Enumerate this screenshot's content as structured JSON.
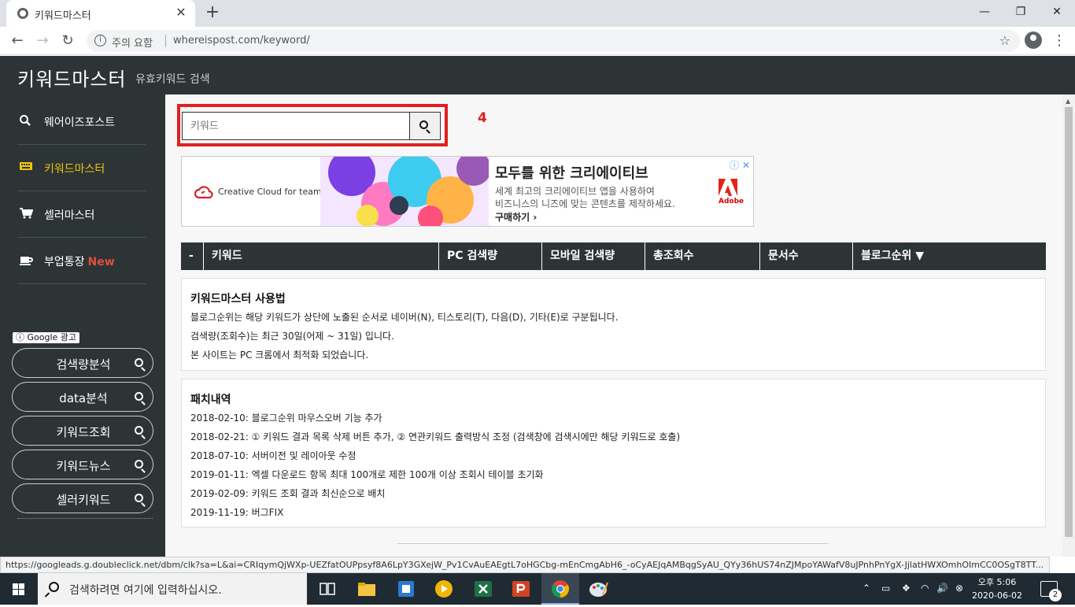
{
  "browser": {
    "tab_title": "키워드마스터",
    "new_tab": "+",
    "window_min": "—",
    "window_max": "❐",
    "window_close": "✕",
    "back": "←",
    "forward": "→",
    "reload": "↻",
    "security_info": "i",
    "security_text": "주의 요함",
    "url": "whereispost.com/keyword/",
    "bookmark_star": "☆",
    "menu": "⋮",
    "status_url": "https://googleads.g.doubleclick.net/dbm/clk?sa=L&ai=CRIqymQjWXp-UEZfatOUPpsyf8A6LpY3GXejW_Pv1CvAuEAEgtL7oHGCbg-mEnCmgAbH6_-oCyAEJqAMBqgSyAU_QYy36hUS74nZJMpoYAWafV8uJPnhPnYgX-JjlatHWXOmhOImCC0OSgT8TT..."
  },
  "site": {
    "title": "키워드마스터",
    "subtitle": "유효키워드 검색"
  },
  "sidebar": {
    "items": [
      {
        "label": "웨어이즈포스트",
        "icon": "search-icon",
        "glyph": "🔍"
      },
      {
        "label": "키워드마스터",
        "icon": "keyboard-icon",
        "glyph": "⌨"
      },
      {
        "label": "셀러마스터",
        "icon": "cart-icon",
        "glyph": "🛒"
      },
      {
        "label": "부업통장",
        "icon": "coffee-icon",
        "glyph": "☕",
        "badge": "New"
      }
    ],
    "google_ad_label": "ⓘ Google 광고",
    "ad_buttons": [
      "검색량분석",
      "data분석",
      "키워드조회",
      "키워드뉴스",
      "셀러키워드"
    ]
  },
  "search": {
    "placeholder": "키워드",
    "value": "",
    "annotation": "4"
  },
  "ad": {
    "brand_text": "Creative Cloud for teams",
    "headline": "모두를 위한 크리에이티브",
    "body_line1": "세계 최고의 크리에이티브 앱을 사용하여",
    "body_line2": "비즈니스의 니즈에 맞는 콘텐츠를 제작하세요.",
    "cta": "구매하기 ›",
    "adchoices": "ⓘ ✕",
    "adobe_text": "Adobe"
  },
  "table": {
    "headers": [
      "-",
      "키워드",
      "PC 검색량",
      "모바일 검색량",
      "총조회수",
      "문서수",
      "블로그순위 ▼"
    ]
  },
  "usage": {
    "title": "키워드마스터 사용법",
    "lines": [
      "블로그순위는 해당 키워드가 상단에 노출된 순서로 네이버(N), 티스토리(T), 다음(D), 기타(E)로 구분됩니다.",
      "검색량(조회수)는 최근 30일(어제 ~ 31일) 입니다.",
      "본 사이트는 PC 크롬에서 최적화 되었습니다."
    ]
  },
  "patch": {
    "title": "패치내역",
    "lines": [
      "2018-02-10: 블로그순위 마우스오버 기능 추가",
      "2018-02-21: ① 키워드 결과 목록 삭제 버튼 추가, ② 연관키워드 출력방식 조정 (검색창에 검색시에만 해당 키워드로 호출)",
      "2018-07-10: 서버이전 및 레이아웃 수정",
      "2019-01-11: 엑셀 다운로드 항목 최대 100개로 제한 100개 이상 조회시 테이블 초기화",
      "2019-02-09: 키워드 조회 결과 최신순으로 배치",
      "2019-11-19: 버그FIX"
    ]
  },
  "taskbar": {
    "search_placeholder": "검색하려면 여기에 입력하십시오.",
    "clock_time": "오후 5:06",
    "clock_date": "2020-06-02",
    "notifications": "2",
    "tray_icons": [
      "chevron-up-icon",
      "battery-icon",
      "dropbox-icon",
      "wifi-icon",
      "volume-icon",
      "close-circle-icon"
    ],
    "tray_glyphs": [
      "⌃",
      "▭",
      "❖",
      "◠",
      "🔊",
      "⊗"
    ],
    "apps": [
      {
        "name": "task-view-icon",
        "color": "#1f2a33"
      },
      {
        "name": "file-explorer-icon",
        "color": "#f4c542"
      },
      {
        "name": "store-icon",
        "color": "#2a7ad5"
      },
      {
        "name": "media-player-icon",
        "color": "#f2b705"
      },
      {
        "name": "excel-icon",
        "color": "#1e7145"
      },
      {
        "name": "powerpoint-icon",
        "color": "#d04423"
      },
      {
        "name": "chrome-icon",
        "color": "#4285f4"
      },
      {
        "name": "paint-icon",
        "color": "#8ab4f8"
      }
    ]
  },
  "colors": {
    "header_bg": "#2d3436",
    "accent_yellow": "#f1c40f",
    "highlight_red": "#e02020",
    "new_badge": "#e74c3c"
  }
}
